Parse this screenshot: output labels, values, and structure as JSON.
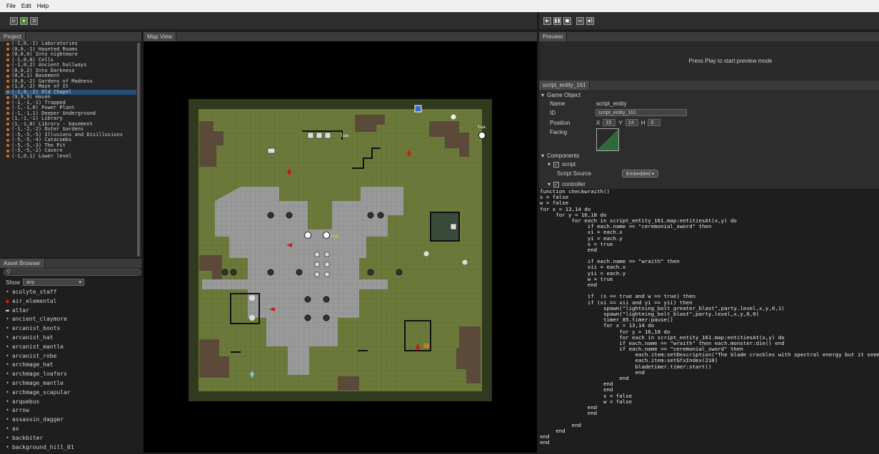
{
  "menu": {
    "file": "File",
    "edit": "Edit",
    "help": "Help"
  },
  "project": {
    "tab": "Project",
    "items": [
      "(-1,0,-1) Laboratories",
      "(0,0,-1) Haunted Rooms",
      "(0,0,0) Into nightmare",
      "(-1,0,0) Cells",
      "(-1,0,2) Ancient hallways",
      "(0,0,2) Into Darkness",
      "(0,0,1) Basement",
      "(0,0,-2) Gardens of Madness",
      "(1,0,-2) Maze of It",
      "(-1,0,-2) Old Chapel",
      "(9,9,9) Haven",
      "(-1,-1,-1) Trapped",
      "(-1,-1,0) Power Plant",
      "(-1,-1,1) Deeper Underground",
      "(1,-1,-1) Library",
      "(1,-1,0) Library - basement",
      "(-1,-2,-2) Outer Gardens",
      "(-5,-5,-5) Illusions and Disillusions",
      "(-5,-5,-4) Catacombs",
      "(-5,-5,-3) The Pit",
      "(-5,-5,-2) Cavern",
      "(-1,0,1) Lower level"
    ],
    "selected_index": 9
  },
  "assets": {
    "tab": "Asset Browser",
    "show_label": "Show",
    "show_value": "any",
    "items": [
      "acolyte_staff",
      "air_elemental",
      "altar",
      "ancient_claymore",
      "arcanist_boots",
      "arcanist_hat",
      "arcanist_mantle",
      "arcanist_robe",
      "archmage_hat",
      "archmage_loafers",
      "archmage_mantle",
      "archmage_scapular",
      "arquebus",
      "arrow",
      "assassin_dagger",
      "ax",
      "backbiter",
      "background_hill_01"
    ]
  },
  "map": {
    "tab": "Map View",
    "label_lua_1": "lua",
    "label_lua_2": "lua",
    "label_lua_3": "lua"
  },
  "preview": {
    "tab": "Preview",
    "message": "Press Play to start preview mode"
  },
  "inspector": {
    "tab": "script_entity_161",
    "game_object": "Game Object",
    "name_label": "Name",
    "name_value": "script_entity",
    "id_label": "ID",
    "id_value": "script_entity_161",
    "position_label": "Position",
    "x_label": "X",
    "x_value": "15",
    "y_label": "Y",
    "y_value": "14",
    "h_label": "H",
    "h_value": "0",
    "facing_label": "Facing",
    "components": "Components",
    "script": "script",
    "script_source_label": "Script Source",
    "script_source_value": "Embedded",
    "controller": "controller"
  },
  "code": [
    "function checkwraith()",
    "s = false",
    "w = false",
    "for x = 13,14 do",
    "     for y = 16,18 do",
    "          for each in script_entity_161.map:entitiesAt(x,y) do",
    "               if each.name == \"ceremonial_sword\" then",
    "               xi = each.x",
    "               yi = each.y",
    "               s = true",
    "               end",
    "",
    "               if each.name == \"wraith\" then",
    "               xii = each.x",
    "               yii = each.y",
    "               w = true",
    "               end",
    "",
    "               if  (s == true and w == true) then",
    "               if (xi == xii and yi == yii) then",
    "                    spawn(\"lightning_bolt_greater_blast\",party.level,x,y,0,1)",
    "                    spawn(\"lightning_bolt_blast\",party.level,x,y,0,0)",
    "                    timer_85.timer:pause()",
    "                    for x = 13,14 do",
    "                         for y = 16,18 do",
    "                         for each in script_entity_161.map:entitiesAt(x,y) do",
    "                         if each.name == \"wraith\" then each.monster:die() end",
    "                         if each.name == \"ceremonial_sword\" then",
    "                              each.item:setDescription(\"The blade crackles with spectral energy but it seems to",
    "                              each.item:setGfxIndex(210)",
    "                              bladetimer.timer:start()",
    "                              end",
    "                         end",
    "                    end",
    "                    end",
    "                    s = false",
    "                    w = false",
    "               end",
    "               end",
    "",
    "          end",
    "     end",
    "end",
    "end"
  ],
  "colors": {
    "selection": "#264f78",
    "grass": "#6b7a3a",
    "wall": "#2f3a1e",
    "floor": "#9a9a9a",
    "marker": "#e07020"
  }
}
